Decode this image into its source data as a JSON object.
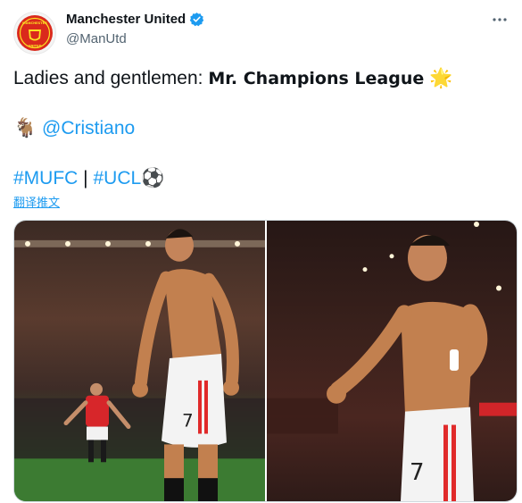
{
  "account": {
    "display_name": "Manchester United",
    "handle": "@ManUtd",
    "verified": true,
    "avatar_icon": "manchester-united-crest-icon",
    "avatar_crest_text": [
      "MANCHESTER",
      "UNITED"
    ]
  },
  "tweet": {
    "line1_prefix": "Ladies and gentlemen: ",
    "line1_bold": "Mr. Champions League",
    "line1_emoji": "🌟",
    "line2_emoji": "🐐",
    "line2_mention": "@Cristiano",
    "line3_hashtag1": "#MUFC",
    "line3_separator": " | ",
    "line3_hashtag2": "#UCL",
    "line3_emoji": "⚽",
    "translate_label": "翻译推文"
  },
  "media": {
    "photos": [
      {
        "icon": "photo-player-celebrating-pitch"
      },
      {
        "icon": "photo-player-celebrating-closeup"
      }
    ],
    "shirt_number": "7"
  },
  "colors": {
    "link": "#1d9bf0",
    "text": "#0f1419",
    "secondary": "#536471",
    "verified": "#1d9bf0",
    "crest_red": "#da291c"
  }
}
